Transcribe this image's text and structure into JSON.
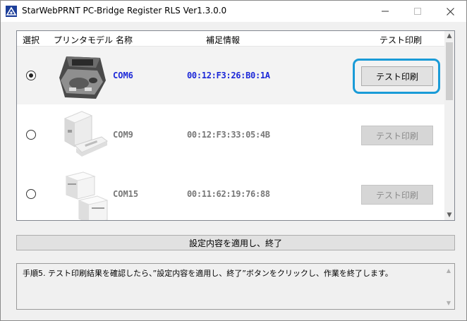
{
  "window": {
    "title": "StarWebPRNT PC-Bridge Register RLS  Ver1.3.0.0",
    "min_glyph": "—",
    "max_glyph": "☐",
    "close_glyph": "✕"
  },
  "list": {
    "headers": {
      "select": "選択",
      "model": "プリンタモデル",
      "name": "名称",
      "info": "補足情報",
      "test": "テスト印刷"
    },
    "rows": [
      {
        "selected": true,
        "model_icon": "mobile-printer-icon",
        "name": "COM6",
        "info": "00:12:F3:26:B0:1A",
        "test_label": "テスト印刷",
        "enabled": true
      },
      {
        "selected": false,
        "model_icon": "receipt-printer-icon",
        "name": "COM9",
        "info": "00:12:F3:33:05:4B",
        "test_label": "テスト印刷",
        "enabled": false
      },
      {
        "selected": false,
        "model_icon": "cube-printer-icon",
        "name": "COM15",
        "info": "00:11:62:19:76:88",
        "test_label": "テスト印刷",
        "enabled": false
      }
    ]
  },
  "apply_button": "設定内容を適用し、終了",
  "message": "手順5. テスト印刷結果を確認したら、”設定内容を適用し、終了”ボタンをクリックし、作業を終了します。",
  "colors": {
    "selected_text": "#1c28d8",
    "highlight": "#1a9bd7"
  }
}
